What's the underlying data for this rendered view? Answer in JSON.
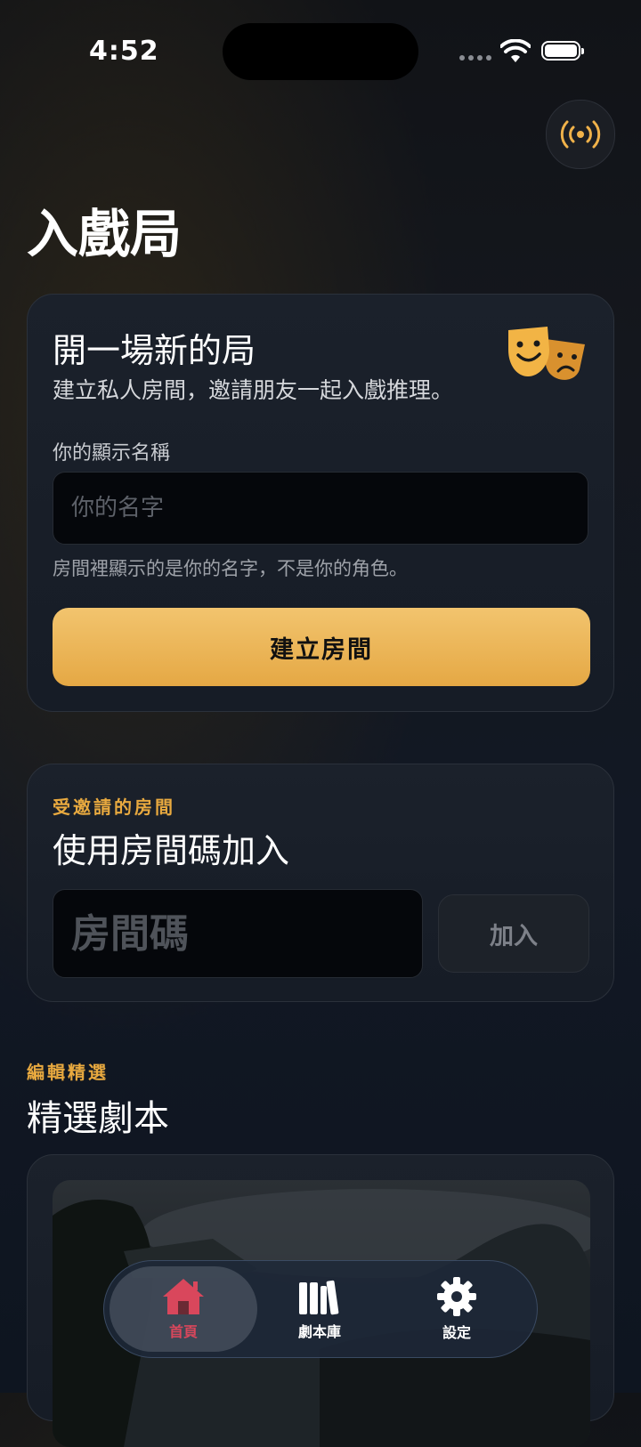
{
  "status_bar": {
    "time": "4:52"
  },
  "header": {
    "title": "入戲局",
    "broadcast_icon": "broadcast-icon"
  },
  "create_room": {
    "title": "開一場新的局",
    "subtitle": "建立私人房間，邀請朋友一起入戲推理。",
    "icon": "theater-masks-icon",
    "name_label": "你的顯示名稱",
    "name_value": "",
    "name_placeholder": "你的名字",
    "name_hint": "房間裡顯示的是你的名字，不是你的角色。",
    "button_label": "建立房間"
  },
  "join_room": {
    "eyebrow": "受邀請的房間",
    "title": "使用房間碼加入",
    "code_value": "",
    "code_placeholder": "房間碼",
    "button_label": "加入"
  },
  "featured": {
    "eyebrow": "編輯精選",
    "title": "精選劇本"
  },
  "tab_bar": {
    "items": [
      {
        "label": "首頁",
        "icon": "home-icon",
        "active": true,
        "color": "#d9475c"
      },
      {
        "label": "劇本庫",
        "icon": "books-icon",
        "active": false
      },
      {
        "label": "設定",
        "icon": "gear-icon",
        "active": false
      }
    ]
  },
  "colors": {
    "accent": "#e8a93f",
    "button_gold": "#f0bc5e",
    "active_tab": "#d9475c"
  }
}
